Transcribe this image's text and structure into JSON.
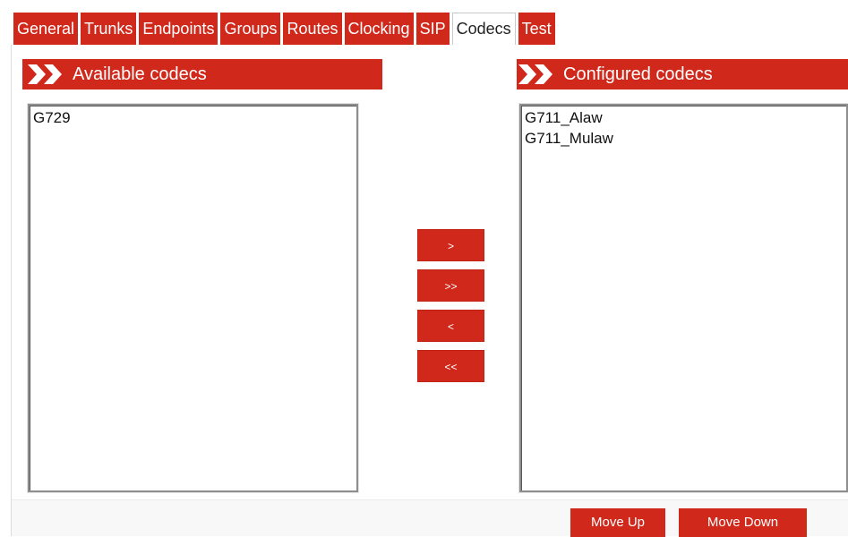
{
  "tabs": [
    {
      "label": "General",
      "active": false
    },
    {
      "label": "Trunks",
      "active": false
    },
    {
      "label": "Endpoints",
      "active": false
    },
    {
      "label": "Groups",
      "active": false
    },
    {
      "label": "Routes",
      "active": false
    },
    {
      "label": "Clocking",
      "active": false
    },
    {
      "label": "SIP",
      "active": false
    },
    {
      "label": "Codecs",
      "active": true
    },
    {
      "label": "Test",
      "active": false
    }
  ],
  "available": {
    "title": "Available codecs",
    "items": [
      "G729"
    ]
  },
  "configured": {
    "title": "Configured codecs",
    "items": [
      "G711_Alaw",
      "G711_Mulaw"
    ]
  },
  "transfer": {
    "add": ">",
    "add_all": ">>",
    "remove": "<",
    "remove_all": "<<"
  },
  "footer": {
    "move_up": "Move Up",
    "move_down": "Move Down"
  },
  "colors": {
    "accent": "#d0281b",
    "background": "#ffffff"
  },
  "icons": {
    "section_header": "double-chevron-right-icon"
  }
}
